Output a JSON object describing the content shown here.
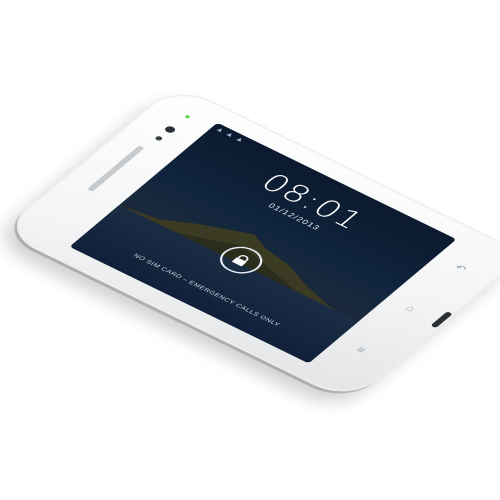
{
  "lock_screen": {
    "time": "08:01",
    "date": "01/12/2013",
    "carrier_text": "NO SIM CARD – EMERGENCY CALLS ONLY"
  },
  "status_bar": {
    "icons": [
      "signal-icon",
      "wifi-icon",
      "alert-icon"
    ]
  },
  "nav_buttons": [
    "back-icon",
    "home-icon",
    "menu-icon"
  ],
  "colors": {
    "led": "#5bc84a",
    "phone_body": "#f4f5f6",
    "screen_bg": "#0b1a2e"
  }
}
